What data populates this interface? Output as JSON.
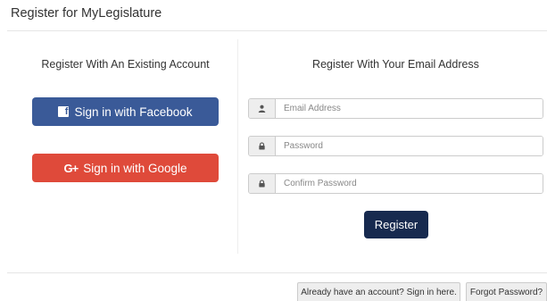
{
  "header": {
    "title": "Register for MyLegislature"
  },
  "left": {
    "heading": "Register With An Existing Account",
    "facebook_label": "Sign in with Facebook",
    "facebook_icon": "f",
    "google_label": "Sign in with Google",
    "google_icon": "G+"
  },
  "right": {
    "heading": "Register With Your Email Address",
    "email": {
      "placeholder": "Email Address",
      "icon": "user-icon"
    },
    "password": {
      "placeholder": "Password",
      "icon": "lock-icon"
    },
    "confirm": {
      "placeholder": "Confirm Password",
      "icon": "lock-icon"
    },
    "register_label": "Register"
  },
  "footer": {
    "sign_in_label": "Already have an account? Sign in here.",
    "forgot_label": "Forgot Password?"
  },
  "colors": {
    "facebook": "#3a5a98",
    "google": "#df4a3a",
    "register": "#172a4f"
  }
}
